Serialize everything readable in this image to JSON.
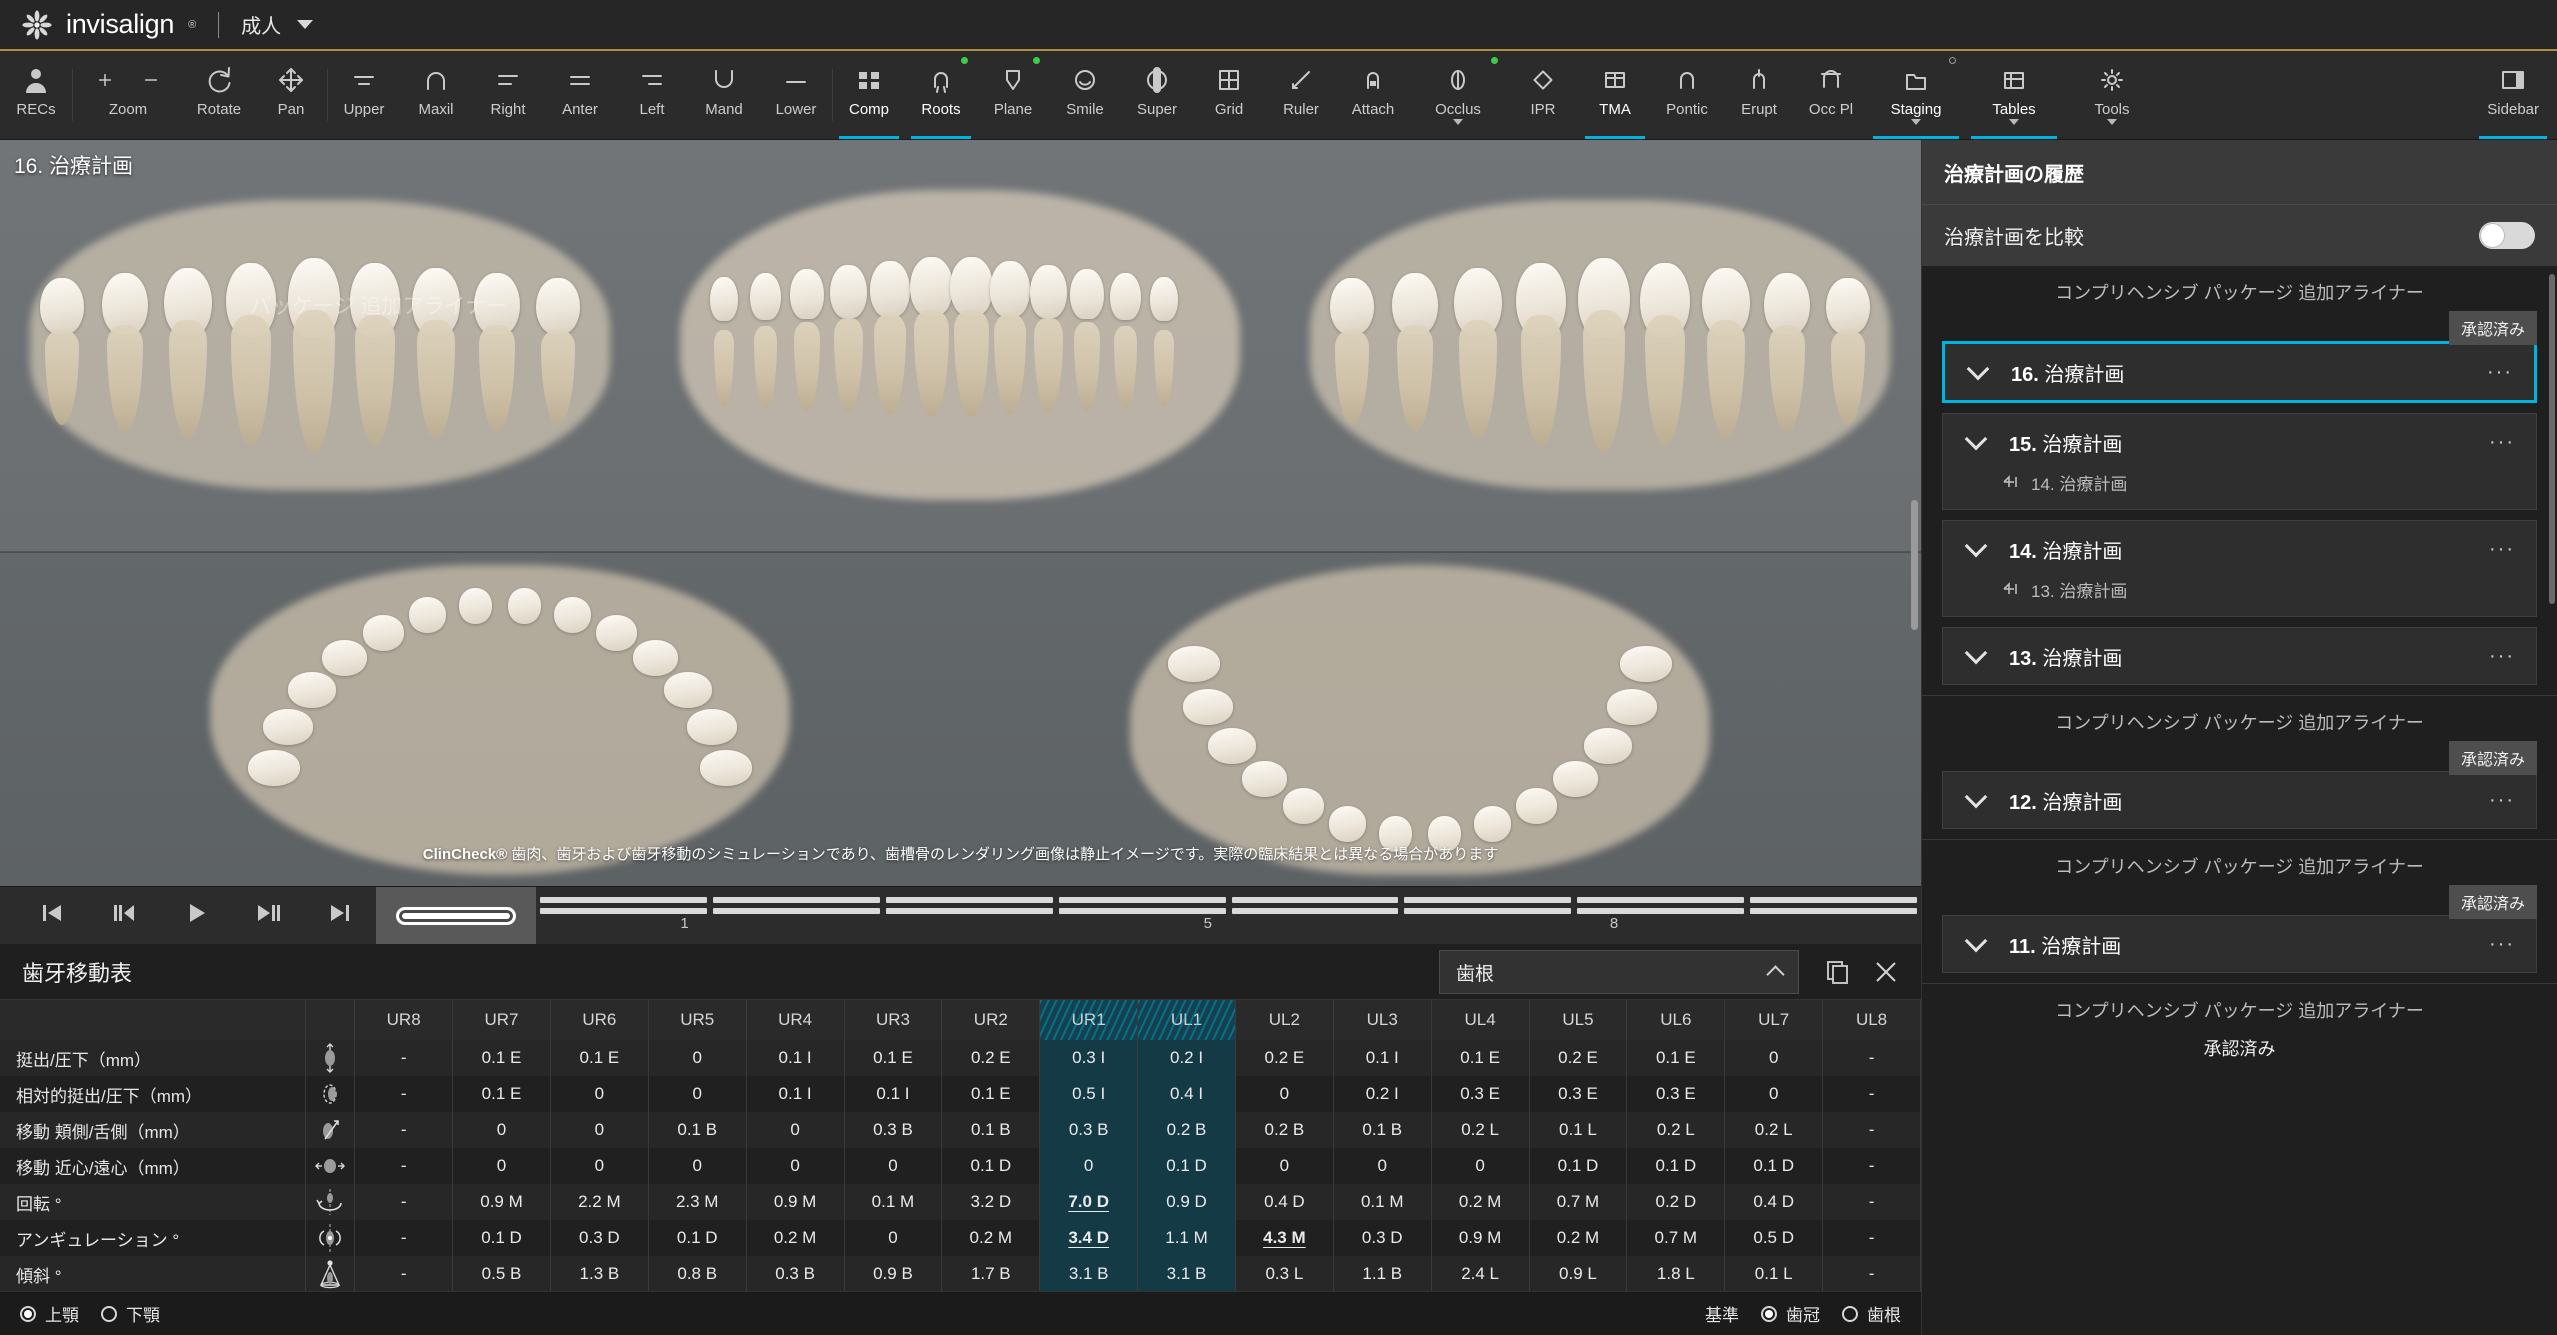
{
  "header": {
    "brand": "invisalign",
    "brand_reg": "®",
    "patient_type": "成人",
    "accent_color": "#b08d3f"
  },
  "toolbar": {
    "accent_color": "#00b4e0",
    "items": [
      {
        "label": "RECs",
        "icon": "person-icon",
        "active": false
      },
      {
        "label": "Zoom",
        "icon": "zoom-plus-minus-icon",
        "active": false
      },
      {
        "label": "Rotate",
        "icon": "rotate-icon",
        "active": false
      },
      {
        "label": "Pan",
        "icon": "pan-icon",
        "active": false
      },
      {
        "label": "Upper",
        "icon": "upper-arch-icon",
        "active": false
      },
      {
        "label": "Maxil",
        "icon": "maxilla-icon",
        "active": false
      },
      {
        "label": "Right",
        "icon": "right-view-icon",
        "active": false
      },
      {
        "label": "Anter",
        "icon": "anterior-view-icon",
        "active": false
      },
      {
        "label": "Left",
        "icon": "left-view-icon",
        "active": false
      },
      {
        "label": "Mand",
        "icon": "mandible-icon",
        "active": false
      },
      {
        "label": "Lower",
        "icon": "lower-arch-icon",
        "active": false
      },
      {
        "label": "Comp",
        "icon": "composite-grid-icon",
        "active": true
      },
      {
        "label": "Roots",
        "icon": "roots-icon",
        "active": true,
        "dot": "green"
      },
      {
        "label": "Plane",
        "icon": "plane-icon",
        "active": false,
        "dot": "green"
      },
      {
        "label": "Smile",
        "icon": "smile-icon",
        "active": false
      },
      {
        "label": "Super",
        "icon": "superimposition-icon",
        "active": false
      },
      {
        "label": "Grid",
        "icon": "grid-icon",
        "active": false
      },
      {
        "label": "Ruler",
        "icon": "ruler-icon",
        "active": false
      },
      {
        "label": "Attach",
        "icon": "attachment-icon",
        "active": false
      },
      {
        "label": "Occlus",
        "icon": "occlusion-icon",
        "active": false,
        "dot": "green",
        "caret": true
      },
      {
        "label": "IPR",
        "icon": "ipr-icon",
        "active": false
      },
      {
        "label": "TMA",
        "icon": "tma-table-icon",
        "active": true
      },
      {
        "label": "Pontic",
        "icon": "pontic-icon",
        "active": false
      },
      {
        "label": "Erupt",
        "icon": "eruption-icon",
        "active": false
      },
      {
        "label": "Occ Pl",
        "icon": "occlusal-plane-icon",
        "active": false
      },
      {
        "label": "Staging",
        "icon": "staging-icon",
        "active": true,
        "dot": "hollow",
        "caret": true
      },
      {
        "label": "Tables",
        "icon": "tables-icon",
        "active": true,
        "caret": true
      },
      {
        "label": "Tools",
        "icon": "tools-gear-icon",
        "active": false,
        "caret": true
      }
    ],
    "sidebar_toggle": {
      "label": "Sidebar",
      "icon": "sidebar-panel-icon",
      "active": true
    }
  },
  "viewer": {
    "stage_label": "16. 治療計画",
    "package_watermark": "パッケージ 追加アライナー",
    "disclaimer_bold": "ClinCheck®",
    "disclaimer_rest": " 歯肉、歯牙および歯牙移動のシミュレーションであり、歯槽骨のレンダリング画像は静止イメージです。実際の臨床結果とは異なる場合があります"
  },
  "playback": {
    "buttons": [
      {
        "name": "go-to-start",
        "icon": "skip-to-start-icon"
      },
      {
        "name": "step-back",
        "icon": "step-backward-icon"
      },
      {
        "name": "play",
        "icon": "play-icon"
      },
      {
        "name": "play-pause",
        "icon": "play-pause-icon"
      },
      {
        "name": "go-to-end",
        "icon": "skip-to-end-icon"
      }
    ],
    "ticks": [
      {
        "label": "1",
        "pos": 10.5
      },
      {
        "label": "5",
        "pos": 48.5
      },
      {
        "label": "8",
        "pos": 78.0
      }
    ],
    "segment_count": 8
  },
  "table": {
    "title": "歯牙移動表",
    "select_value": "歯根",
    "copy_icon": "copy-icon",
    "close_icon": "close-icon",
    "columns": [
      "UR8",
      "UR7",
      "UR6",
      "UR5",
      "UR4",
      "UR3",
      "UR2",
      "UR1",
      "UL1",
      "UL2",
      "UL3",
      "UL4",
      "UL5",
      "UL6",
      "UL7",
      "UL8"
    ],
    "selected_columns": [
      "UR1",
      "UL1"
    ],
    "rows": [
      {
        "label": "挺出/圧下（mm）",
        "icon": "extrusion-intrusion-icon",
        "values": [
          "-",
          "0.1 E",
          "0.1 E",
          "0",
          "0.1 I",
          "0.1 E",
          "0.2 E",
          "0.3 I",
          "0.2 I",
          "0.2 E",
          "0.1 I",
          "0.1 E",
          "0.2 E",
          "0.1 E",
          "0",
          "-"
        ],
        "underline": []
      },
      {
        "label": "相対的挺出/圧下（mm）",
        "icon": "relative-extrusion-icon",
        "values": [
          "-",
          "0.1 E",
          "0",
          "0",
          "0.1 I",
          "0.1 I",
          "0.1 E",
          "0.5 I",
          "0.4 I",
          "0",
          "0.2 I",
          "0.3 E",
          "0.3 E",
          "0.3 E",
          "0",
          "-"
        ],
        "underline": []
      },
      {
        "label": "移動 頬側/舌側（mm）",
        "icon": "buccal-lingual-translation-icon",
        "values": [
          "-",
          "0",
          "0",
          "0.1 B",
          "0",
          "0.3 B",
          "0.1 B",
          "0.3 B",
          "0.2 B",
          "0.2 B",
          "0.1 B",
          "0.2 L",
          "0.1 L",
          "0.2 L",
          "0.2 L",
          "-"
        ],
        "underline": []
      },
      {
        "label": "移動 近心/遠心（mm）",
        "icon": "mesial-distal-translation-icon",
        "values": [
          "-",
          "0",
          "0",
          "0",
          "0",
          "0",
          "0.1 D",
          "0",
          "0.1 D",
          "0",
          "0",
          "0",
          "0.1 D",
          "0.1 D",
          "0.1 D",
          "-"
        ],
        "underline": []
      },
      {
        "label": "回転 °",
        "icon": "rotation-icon",
        "values": [
          "-",
          "0.9 M",
          "2.2 M",
          "2.3 M",
          "0.9 M",
          "0.1 M",
          "3.2 D",
          "7.0 D",
          "0.9 D",
          "0.4 D",
          "0.1 M",
          "0.2 M",
          "0.7 M",
          "0.2 D",
          "0.4 D",
          "-"
        ],
        "underline": [
          "UR1"
        ]
      },
      {
        "label": "アンギュレーション °",
        "icon": "angulation-icon",
        "values": [
          "-",
          "0.1 D",
          "0.3 D",
          "0.1 D",
          "0.2 M",
          "0",
          "0.2 M",
          "3.4 D",
          "1.1 M",
          "4.3 M",
          "0.3 D",
          "0.9 M",
          "0.2 M",
          "0.7 M",
          "0.5 D",
          "-"
        ],
        "underline": [
          "UR1",
          "UL2"
        ]
      },
      {
        "label": "傾斜 °",
        "icon": "inclination-icon",
        "values": [
          "-",
          "0.5 B",
          "1.3 B",
          "0.8 B",
          "0.3 B",
          "0.9 B",
          "1.7 B",
          "3.1 B",
          "3.1 B",
          "0.3 L",
          "1.1 B",
          "2.4 L",
          "0.9 L",
          "1.8 L",
          "0.1 L",
          "-"
        ],
        "underline": []
      }
    ],
    "footer": {
      "arch_options": [
        {
          "label": "上顎",
          "selected": true
        },
        {
          "label": "下顎",
          "selected": false
        }
      ],
      "reference_label": "基準",
      "reference_options": [
        {
          "label": "歯冠",
          "selected": true
        },
        {
          "label": "歯根",
          "selected": false
        }
      ]
    }
  },
  "sidebar": {
    "title": "治療計画の履歴",
    "compare_label": "治療計画を比較",
    "compare_on": false,
    "approved_badge": "承認済み",
    "package_label": "コンプリヘンシブ パッケージ 追加アライナー",
    "plans": [
      {
        "number": "16.",
        "name": "治療計画",
        "active": true,
        "menu": "···",
        "package_above": true,
        "badge_above": true,
        "sub": null
      },
      {
        "number": "15.",
        "name": "治療計画",
        "active": false,
        "menu": "···",
        "package_above": false,
        "badge_above": false,
        "sub": "14. 治療計画"
      },
      {
        "number": "14.",
        "name": "治療計画",
        "active": false,
        "menu": "···",
        "package_above": false,
        "badge_above": false,
        "sub": "13. 治療計画"
      },
      {
        "number": "13.",
        "name": "治療計画",
        "active": false,
        "menu": "···",
        "package_above": false,
        "badge_above": false,
        "sub": null
      },
      {
        "number": "12.",
        "name": "治療計画",
        "active": false,
        "menu": "···",
        "package_above": true,
        "badge_above": true,
        "sub": null
      },
      {
        "number": "11.",
        "name": "治療計画",
        "active": false,
        "menu": "···",
        "package_above": true,
        "badge_above": true,
        "sub": null
      }
    ],
    "bottom_package": "コンプリヘンシブ パッケージ 追加アライナー",
    "bottom_approved": "承認済み"
  }
}
